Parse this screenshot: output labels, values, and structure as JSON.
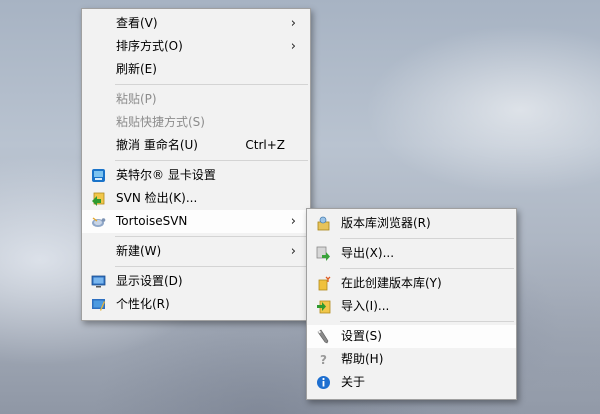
{
  "context_menu": {
    "view": "查看(V)",
    "sort_by": "排序方式(O)",
    "refresh": "刷新(E)",
    "paste": "粘贴(P)",
    "paste_shortcut": "粘贴快捷方式(S)",
    "undo_rename": "撤消 重命名(U)",
    "undo_shortcut": "Ctrl+Z",
    "intel_graphics": "英特尔® 显卡设置",
    "svn_checkout": "SVN 检出(K)...",
    "tortoisesvn": "TortoiseSVN",
    "new": "新建(W)",
    "display_settings": "显示设置(D)",
    "personalize": "个性化(R)"
  },
  "tortoise_submenu": {
    "repo_browser": "版本库浏览器(R)",
    "export": "导出(X)...",
    "create_repo_here": "在此创建版本库(Y)",
    "import": "导入(I)...",
    "settings": "设置(S)",
    "help": "帮助(H)",
    "about": "关于"
  },
  "colors": {
    "menu_bg": "#f2f2f2",
    "disabled_text": "#8c8c8c",
    "separator": "#d4d4d4"
  }
}
